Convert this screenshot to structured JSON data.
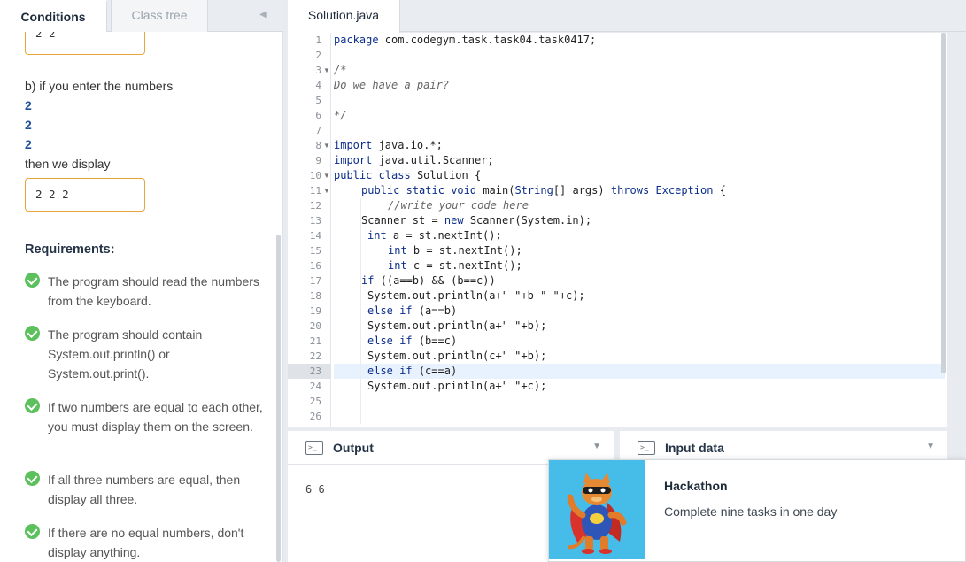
{
  "left_tabs": {
    "conditions": "Conditions",
    "class_tree": "Class tree",
    "collapse_icon": "◀"
  },
  "conditions": {
    "box1": "2 2",
    "b_intro": "b) if you enter the numbers",
    "numbers": [
      "2",
      "2",
      "2"
    ],
    "then": "then we display",
    "box2": "2 2 2",
    "requirements_title": "Requirements:",
    "requirements": [
      "The program should read the numbers from the keyboard.",
      "The program should contain System.out.println() or System.out.print().",
      "If two numbers are equal to each other, you must display them on the screen.",
      "If all three numbers are equal, then display all three.",
      "If there are no equal numbers, don't display anything."
    ]
  },
  "editor": {
    "tab": "Solution.java",
    "line_numbers": [
      "1",
      "2",
      "3",
      "4",
      "5",
      "6",
      "7",
      "8",
      "9",
      "10",
      "11",
      "12",
      "13",
      "14",
      "15",
      "16",
      "17",
      "18",
      "19",
      "20",
      "21",
      "22",
      "23",
      "24",
      "25",
      "26"
    ]
  },
  "output_panel": {
    "title": "Output",
    "text": "6 6"
  },
  "input_panel": {
    "title": "Input data"
  },
  "popup": {
    "title": "Hackathon",
    "text": "Complete nine tasks in one day"
  },
  "colors": {
    "accent_orange": "#e8a43a",
    "check_green": "#5cc05c",
    "keyword_blue": "#0b2e8a",
    "popup_bg": "#45bde8"
  }
}
